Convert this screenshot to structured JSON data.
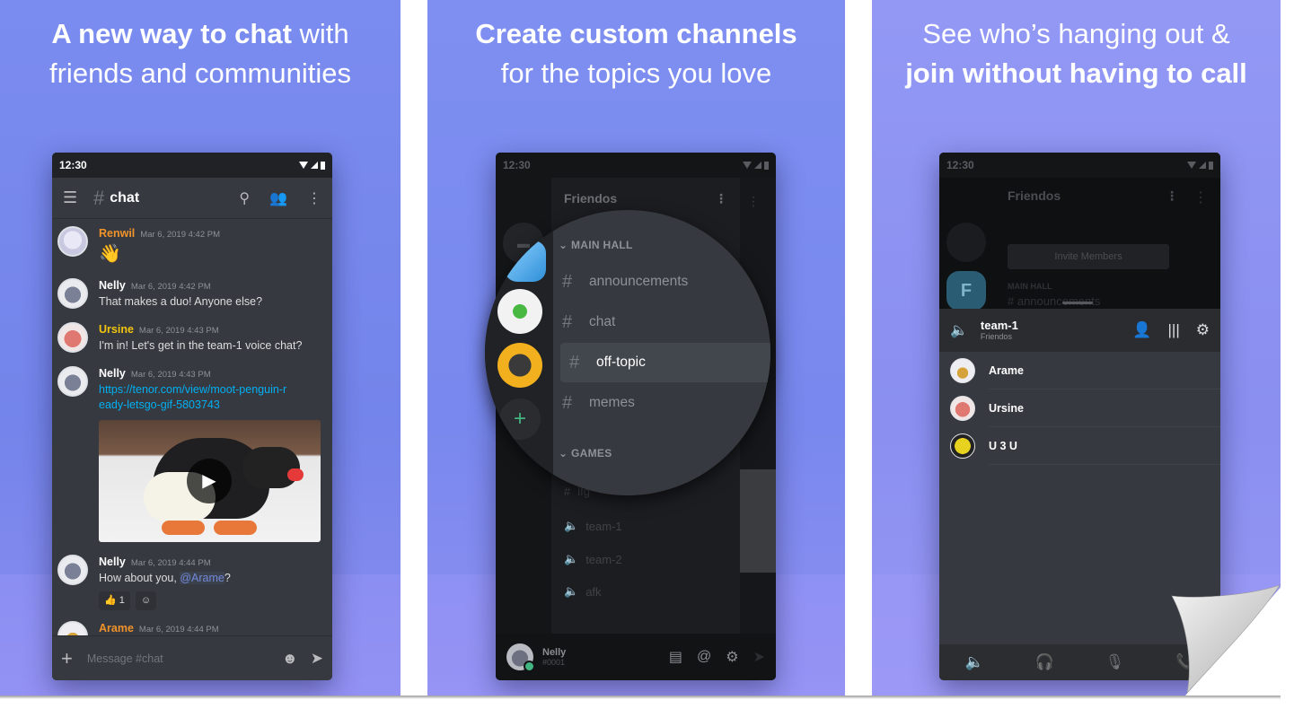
{
  "panels": [
    {
      "headline_bold": "A new way to chat",
      "headline_light": " with",
      "headline_line2": "friends and communities",
      "phone": {
        "status_time": "12:30",
        "channel_title": "chat",
        "messages": [
          {
            "author": "Renwil",
            "author_color": "#f0932b",
            "time": "Mar 6, 2019 4:42 PM",
            "text": "👋"
          },
          {
            "author": "Nelly",
            "author_color": "#ffffff",
            "time": "Mar 6, 2019 4:42 PM",
            "text": "That makes a duo! Anyone else?"
          },
          {
            "author": "Ursine",
            "author_color": "#f1c40f",
            "time": "Mar 6, 2019 4:43 PM",
            "text": "I'm in! Let's get in the team-1 voice chat?"
          },
          {
            "author": "Nelly",
            "author_color": "#ffffff",
            "time": "Mar 6, 2019 4:43 PM",
            "link": "https://tenor.com/view/moot-penguin-ready-letsgo-gif-5803743"
          },
          {
            "author": "Nelly",
            "author_color": "#ffffff",
            "time": "Mar 6, 2019 4:44 PM",
            "text_before": "How about you, ",
            "mention": "@Arame",
            "text_after": "?",
            "reaction_emoji": "👍",
            "reaction_count": "1"
          },
          {
            "author": "Arame",
            "author_color": "#f0932b",
            "time": "Mar 6, 2019 4:44 PM"
          }
        ],
        "composer_placeholder": "Message #chat"
      }
    },
    {
      "headline_bold": "Create custom channels",
      "headline_line2": "for the topics you love",
      "phone": {
        "status_time": "12:30",
        "server_name": "Friendos",
        "categories": [
          {
            "name": "MAIN HALL",
            "channels": [
              "announcements",
              "chat",
              "off-topic",
              "memes"
            ],
            "active": "off-topic"
          },
          {
            "name": "GAMES",
            "channels": [
              "lfg"
            ],
            "voice_channels": [
              "team-1",
              "team-2",
              "afk"
            ]
          }
        ],
        "user": {
          "name": "Nelly",
          "tag": "#0001"
        }
      }
    },
    {
      "headline_line1": "See who’s hanging out &",
      "headline_bold": "join without having to call",
      "phone": {
        "status_time": "12:30",
        "server_name": "Friendos",
        "invite_label": "Invite Members",
        "category": "MAIN HALL",
        "channel": "announcements",
        "voice_channel": {
          "name": "team-1",
          "server": "Friendos"
        },
        "members": [
          "Arame",
          "Ursine",
          "U 3 U"
        ]
      }
    }
  ],
  "colors": {
    "blurple": "#7289da",
    "online": "#43b581",
    "danger": "#f04747",
    "background_dark": "#36393f"
  }
}
